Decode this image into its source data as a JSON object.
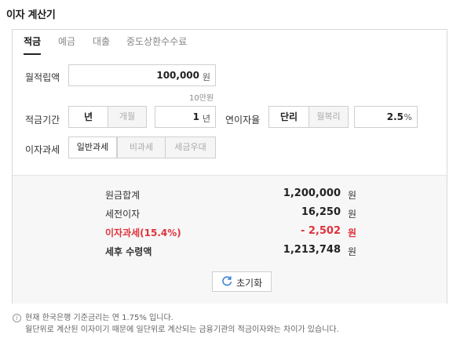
{
  "title": "이자 계산기",
  "tabs": [
    {
      "label": "적금"
    },
    {
      "label": "예금"
    },
    {
      "label": "대출"
    },
    {
      "label": "중도상환수수료"
    }
  ],
  "monthly": {
    "label": "월적립액",
    "value": "100,000",
    "unit": "원",
    "hint": "10만원"
  },
  "period": {
    "label": "적금기간",
    "options": [
      "년",
      "개월"
    ],
    "selected": "년",
    "value": "1",
    "unit": "년"
  },
  "rate": {
    "label": "연이자율",
    "options": [
      "단리",
      "월복리"
    ],
    "selected": "단리",
    "value": "2.5",
    "unit": "%"
  },
  "tax": {
    "label": "이자과세",
    "options": [
      "일반과세",
      "비과세",
      "세금우대"
    ],
    "selected": "일반과세"
  },
  "results": {
    "principal": {
      "label": "원금합계",
      "value": "1,200,000",
      "unit": "원"
    },
    "pretax": {
      "label": "세전이자",
      "value": "16,250",
      "unit": "원"
    },
    "taxamt": {
      "label": "이자과세(15.4%)",
      "value": "- 2,502",
      "unit": "원"
    },
    "net": {
      "label": "세후 수령액",
      "value": "1,213,748",
      "unit": "원"
    }
  },
  "reset_label": "초기화",
  "notes": [
    "현재 한국은행 기준금리는 연 1.75% 입니다.",
    "월단위로 계산된 이자이기 때문에 일단위로 계산되는 금융기관의 적금이자와는 차이가 있습니다."
  ],
  "colors": {
    "accent_red": "#e0323c",
    "refresh_blue": "#3b82d6"
  }
}
